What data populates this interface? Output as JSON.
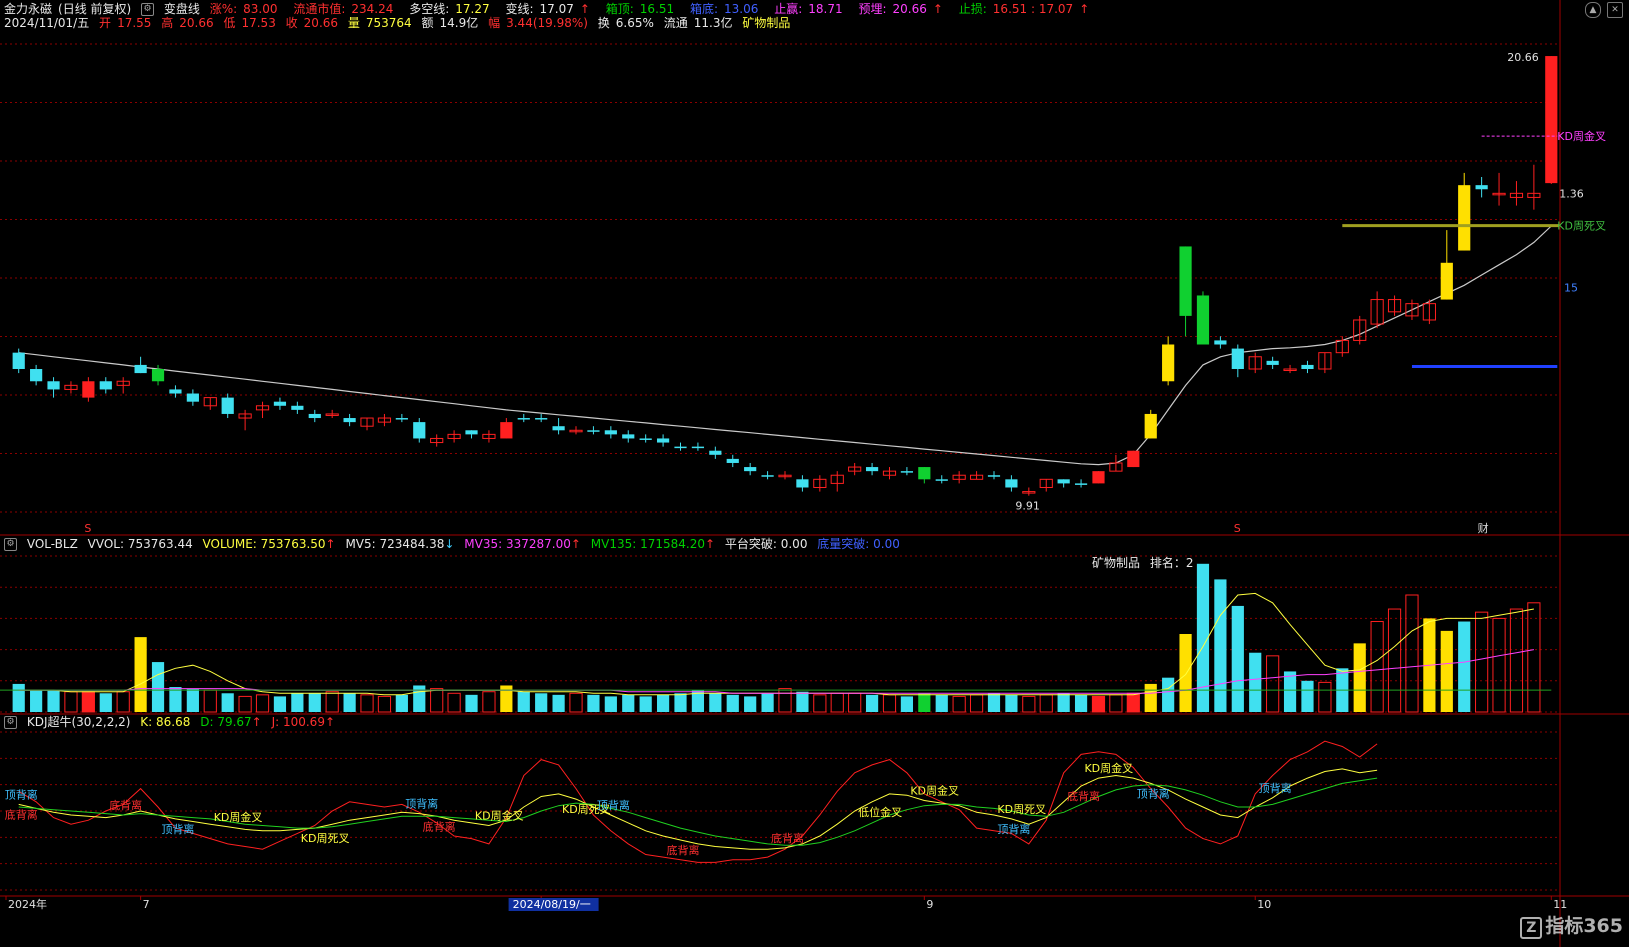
{
  "header": {
    "stock_name": "金力永磁",
    "period": "(日线 前复权)",
    "indicator": "变盘线",
    "zhang_label": "涨%:",
    "zhang_val": "83.00",
    "ltsz_label": "流通市值:",
    "ltsz_val": "234.24",
    "dkx_label": "多空线:",
    "dkx_val": "17.27",
    "bx_label": "变线:",
    "bx_val": "17.07",
    "xt_label": "箱顶:",
    "xt_val": "16.51",
    "xd_label": "箱底:",
    "xd_val": "13.06",
    "zy_label": "止赢:",
    "zy_val": "18.71",
    "yl_label": "预埋:",
    "yl_val": "20.66",
    "zs_label": "止损:",
    "zs_val": "16.51 : 17.07",
    "date": "2024/11/01/五",
    "open_label": "开",
    "open": "17.55",
    "high_label": "高",
    "high": "20.66",
    "low_label": "低",
    "low": "17.53",
    "close_label": "收",
    "close": "20.66",
    "vol_label": "量",
    "vol": "753764",
    "amt_label": "额",
    "amt": "14.9亿",
    "amp_label": "幅",
    "amp": "3.44(19.98%)",
    "turn_label": "换",
    "turn": "6.65%",
    "flow_label": "流通",
    "flow": "11.3亿",
    "sector": "矿物制品"
  },
  "price_panel": {
    "high_label": "20.66",
    "low_label": "9.91",
    "right_tag": "1.36",
    "edge_tag": "15",
    "kd_gold": "KD周金叉",
    "kd_dead": "KD周死叉",
    "markers": [
      {
        "text": "S",
        "color": "#ff3030",
        "pos": 4
      },
      {
        "text": "S",
        "color": "#ff3030",
        "pos": 70
      },
      {
        "text": "财",
        "color": "#dddddd",
        "pos": 84
      }
    ]
  },
  "vol_panel": {
    "name": "VOL-BLZ",
    "vvol": "VVOL: 753763.44",
    "volume": "VOLUME: 753763.50",
    "mv5": "MV5: 723484.38",
    "mv35": "MV35: 337287.00",
    "mv135": "MV135: 171584.20",
    "ptjp": "平台突破: 0.00",
    "dltp": "底量突破: 0.00",
    "sector_text": "矿物制品",
    "rank_text": "排名：2"
  },
  "kdj_panel": {
    "name": "KDJ超牛(30,2,2,2)",
    "k": "K: 86.68",
    "d": "D: 79.67",
    "j": "J: 100.69",
    "labels": [
      {
        "text": "顶背离",
        "color": "#40c0ff",
        "pos": 0
      },
      {
        "text": "底背离",
        "color": "#ff3030",
        "pos": 0
      },
      {
        "text": "底背离",
        "color": "#ff3030",
        "pos": 6
      },
      {
        "text": "顶背离",
        "color": "#40c0ff",
        "pos": 9
      },
      {
        "text": "KD周金叉",
        "color": "#ffff40",
        "pos": 12
      },
      {
        "text": "KD周死叉",
        "color": "#ffff40",
        "pos": 17
      },
      {
        "text": "顶背离",
        "color": "#40c0ff",
        "pos": 23
      },
      {
        "text": "底背离",
        "color": "#ff3030",
        "pos": 24
      },
      {
        "text": "KD周金叉",
        "color": "#ffff40",
        "pos": 27
      },
      {
        "text": "KD周死叉",
        "color": "#ffff40",
        "pos": 32
      },
      {
        "text": "顶背离",
        "color": "#40c0ff",
        "pos": 34
      },
      {
        "text": "底背离",
        "color": "#ff3030",
        "pos": 38
      },
      {
        "text": "底背离",
        "color": "#ff3030",
        "pos": 44
      },
      {
        "text": "低位金叉",
        "color": "#ffff40",
        "pos": 49
      },
      {
        "text": "KD周金叉",
        "color": "#ffff40",
        "pos": 52
      },
      {
        "text": "顶背离",
        "color": "#40c0ff",
        "pos": 57
      },
      {
        "text": "KD周死叉",
        "color": "#ffff40",
        "pos": 57
      },
      {
        "text": "底背离",
        "color": "#ff3030",
        "pos": 61
      },
      {
        "text": "KD周金叉",
        "color": "#ffff40",
        "pos": 62
      },
      {
        "text": "顶背离",
        "color": "#40c0ff",
        "pos": 65
      },
      {
        "text": "顶背离",
        "color": "#40c0ff",
        "pos": 72
      }
    ]
  },
  "xaxis": {
    "labels": [
      {
        "text": "2024年",
        "pos": 0
      },
      {
        "text": "7",
        "pos": 7
      },
      {
        "text": "8",
        "pos": 30
      },
      {
        "text": "9",
        "pos": 52
      },
      {
        "text": "10",
        "pos": 71
      },
      {
        "text": "11",
        "pos": 88
      }
    ],
    "cursor": "2024/08/19/一"
  },
  "logo": "指标365",
  "colors": {
    "up": "#ff2020",
    "down": "#40e0f0",
    "yellow": "#ffe000",
    "green": "#10d030",
    "ma": "#40d0e0",
    "ma2": "#e0e0e0",
    "grid": "#8b0000"
  },
  "chart_data": {
    "type": "candlestick",
    "ylim": [
      9.5,
      21.2
    ],
    "candles": [
      [
        13.4,
        13.5,
        12.9,
        13.0,
        "c"
      ],
      [
        13.0,
        13.1,
        12.6,
        12.7,
        "c"
      ],
      [
        12.7,
        12.8,
        12.3,
        12.5,
        "c"
      ],
      [
        12.5,
        12.7,
        12.4,
        12.6,
        "w"
      ],
      [
        12.3,
        12.8,
        12.2,
        12.7,
        "r"
      ],
      [
        12.7,
        12.8,
        12.4,
        12.5,
        "c"
      ],
      [
        12.6,
        12.8,
        12.4,
        12.7,
        "w"
      ],
      [
        12.9,
        13.3,
        12.9,
        13.1,
        "c"
      ],
      [
        12.7,
        13.1,
        12.6,
        13.0,
        "g"
      ],
      [
        12.5,
        12.6,
        12.3,
        12.4,
        "c"
      ],
      [
        12.4,
        12.5,
        12.1,
        12.2,
        "c"
      ],
      [
        12.1,
        12.3,
        12.0,
        12.3,
        "w"
      ],
      [
        12.3,
        12.4,
        11.8,
        11.9,
        "c"
      ],
      [
        11.8,
        12.0,
        11.5,
        11.9,
        "w"
      ],
      [
        12.0,
        12.2,
        11.8,
        12.1,
        "w"
      ],
      [
        12.2,
        12.3,
        12.0,
        12.1,
        "c"
      ],
      [
        12.1,
        12.2,
        11.9,
        12.0,
        "c"
      ],
      [
        11.9,
        12.0,
        11.7,
        11.8,
        "c"
      ],
      [
        11.9,
        12.0,
        11.8,
        11.9,
        "w"
      ],
      [
        11.8,
        11.9,
        11.6,
        11.7,
        "c"
      ],
      [
        11.6,
        11.8,
        11.5,
        11.8,
        "w"
      ],
      [
        11.8,
        11.9,
        11.6,
        11.7,
        "w"
      ],
      [
        11.8,
        11.9,
        11.7,
        11.8,
        "c"
      ],
      [
        11.7,
        11.8,
        11.2,
        11.3,
        "c"
      ],
      [
        11.2,
        11.4,
        11.1,
        11.3,
        "w"
      ],
      [
        11.3,
        11.5,
        11.2,
        11.4,
        "w"
      ],
      [
        11.5,
        11.5,
        11.3,
        11.4,
        "c"
      ],
      [
        11.3,
        11.5,
        11.2,
        11.4,
        "w"
      ],
      [
        11.3,
        11.8,
        11.3,
        11.7,
        "r"
      ],
      [
        11.8,
        11.9,
        11.7,
        11.8,
        "c"
      ],
      [
        11.8,
        11.9,
        11.7,
        11.8,
        "c"
      ],
      [
        11.6,
        11.8,
        11.4,
        11.5,
        "c"
      ],
      [
        11.5,
        11.6,
        11.4,
        11.5,
        "w"
      ],
      [
        11.5,
        11.6,
        11.4,
        11.5,
        "c"
      ],
      [
        11.5,
        11.6,
        11.3,
        11.4,
        "c"
      ],
      [
        11.3,
        11.5,
        11.2,
        11.4,
        "c"
      ],
      [
        11.3,
        11.4,
        11.2,
        11.3,
        "c"
      ],
      [
        11.3,
        11.4,
        11.1,
        11.2,
        "c"
      ],
      [
        11.1,
        11.2,
        11.0,
        11.1,
        "c"
      ],
      [
        11.1,
        11.2,
        11.0,
        11.1,
        "c"
      ],
      [
        11.0,
        11.1,
        10.8,
        10.9,
        "c"
      ],
      [
        10.8,
        10.9,
        10.6,
        10.7,
        "c"
      ],
      [
        10.6,
        10.7,
        10.4,
        10.5,
        "c"
      ],
      [
        10.4,
        10.5,
        10.3,
        10.4,
        "c"
      ],
      [
        10.4,
        10.5,
        10.3,
        10.4,
        "w"
      ],
      [
        10.3,
        10.4,
        10.0,
        10.1,
        "c"
      ],
      [
        10.1,
        10.4,
        10.0,
        10.3,
        "w"
      ],
      [
        10.2,
        10.5,
        10.0,
        10.4,
        "w"
      ],
      [
        10.5,
        10.7,
        10.4,
        10.6,
        "w"
      ],
      [
        10.6,
        10.7,
        10.4,
        10.5,
        "c"
      ],
      [
        10.4,
        10.6,
        10.3,
        10.5,
        "w"
      ],
      [
        10.5,
        10.6,
        10.4,
        10.5,
        "c"
      ],
      [
        10.6,
        10.6,
        10.2,
        10.3,
        "g"
      ],
      [
        10.3,
        10.4,
        10.2,
        10.3,
        "c"
      ],
      [
        10.3,
        10.5,
        10.2,
        10.4,
        "w"
      ],
      [
        10.3,
        10.5,
        10.3,
        10.4,
        "w"
      ],
      [
        10.4,
        10.5,
        10.3,
        10.4,
        "c"
      ],
      [
        10.3,
        10.4,
        10.0,
        10.1,
        "c"
      ],
      [
        10.0,
        10.1,
        9.9,
        10.0,
        "w"
      ],
      [
        10.1,
        10.3,
        10.0,
        10.3,
        "w"
      ],
      [
        10.3,
        10.3,
        10.1,
        10.2,
        "c"
      ],
      [
        10.2,
        10.3,
        10.1,
        10.2,
        "c"
      ],
      [
        10.2,
        10.5,
        10.2,
        10.5,
        "r"
      ],
      [
        10.5,
        10.9,
        10.5,
        10.7,
        "w"
      ],
      [
        10.6,
        11.0,
        10.6,
        11.0,
        "r"
      ],
      [
        11.3,
        12.0,
        11.3,
        11.9,
        "y"
      ],
      [
        12.7,
        13.8,
        12.6,
        13.6,
        "y"
      ],
      [
        16.0,
        16.0,
        13.8,
        14.3,
        "g"
      ],
      [
        14.8,
        14.9,
        13.6,
        13.6,
        "g"
      ],
      [
        13.7,
        13.8,
        13.5,
        13.6,
        "c"
      ],
      [
        13.5,
        13.6,
        12.8,
        13.0,
        "c"
      ],
      [
        13.0,
        13.4,
        12.9,
        13.3,
        "w"
      ],
      [
        13.2,
        13.3,
        13.0,
        13.1,
        "c"
      ],
      [
        13.0,
        13.1,
        12.9,
        13.0,
        "w"
      ],
      [
        13.1,
        13.2,
        12.9,
        13.0,
        "c"
      ],
      [
        13.0,
        13.4,
        12.9,
        13.4,
        "w"
      ],
      [
        13.4,
        13.8,
        13.3,
        13.7,
        "w"
      ],
      [
        13.7,
        14.3,
        13.6,
        14.2,
        "w"
      ],
      [
        14.1,
        14.9,
        14.0,
        14.7,
        "w"
      ],
      [
        14.4,
        14.8,
        14.3,
        14.7,
        "w"
      ],
      [
        14.3,
        14.7,
        14.2,
        14.6,
        "w"
      ],
      [
        14.2,
        14.7,
        14.1,
        14.6,
        "w"
      ],
      [
        14.7,
        16.4,
        14.7,
        15.6,
        "y"
      ],
      [
        15.9,
        17.8,
        15.9,
        17.5,
        "y"
      ],
      [
        17.4,
        17.7,
        17.2,
        17.5,
        "c"
      ],
      [
        17.3,
        17.8,
        17.0,
        17.3,
        "w"
      ],
      [
        17.3,
        17.6,
        17.0,
        17.2,
        "w"
      ],
      [
        17.2,
        18.0,
        16.9,
        17.3,
        "w"
      ],
      [
        17.55,
        20.66,
        17.53,
        20.66,
        "r"
      ]
    ],
    "ma": [
      13.4,
      13.35,
      13.3,
      13.25,
      13.2,
      13.15,
      13.1,
      13.05,
      13.0,
      12.95,
      12.9,
      12.85,
      12.8,
      12.75,
      12.7,
      12.65,
      12.6,
      12.55,
      12.5,
      12.45,
      12.4,
      12.35,
      12.3,
      12.25,
      12.2,
      12.15,
      12.1,
      12.05,
      12.0,
      11.96,
      11.92,
      11.88,
      11.84,
      11.8,
      11.76,
      11.72,
      11.68,
      11.64,
      11.6,
      11.56,
      11.52,
      11.48,
      11.44,
      11.4,
      11.36,
      11.32,
      11.28,
      11.24,
      11.2,
      11.16,
      11.12,
      11.08,
      11.04,
      11.0,
      10.96,
      10.92,
      10.88,
      10.84,
      10.8,
      10.76,
      10.72,
      10.68,
      10.66,
      10.7,
      10.9,
      11.4,
      12.0,
      12.6,
      13.1,
      13.3,
      13.4,
      13.45,
      13.5,
      13.52,
      13.55,
      13.6,
      13.7,
      13.85,
      14.05,
      14.25,
      14.45,
      14.65,
      14.85,
      15.05,
      15.3,
      15.55,
      15.8,
      16.1,
      16.5
    ],
    "volume": [
      18,
      14,
      14,
      13,
      13,
      12,
      13,
      48,
      32,
      16,
      15,
      14,
      12,
      10,
      11,
      10,
      12,
      12,
      13,
      12,
      11,
      10,
      11,
      17,
      15,
      12,
      11,
      13,
      17,
      13,
      12,
      11,
      12,
      11,
      10,
      11,
      10,
      11,
      12,
      14,
      12,
      11,
      10,
      12,
      15,
      13,
      11,
      12,
      12,
      11,
      11,
      10,
      12,
      11,
      10,
      11,
      12,
      11,
      10,
      11,
      12,
      11,
      10,
      11,
      12,
      18,
      22,
      50,
      95,
      85,
      68,
      38,
      36,
      26,
      20,
      19,
      28,
      44,
      58,
      66,
      75,
      60,
      52,
      58,
      64,
      60,
      66,
      70
    ],
    "volume_colors": [
      "c",
      "c",
      "c",
      "w",
      "r",
      "c",
      "w",
      "y",
      "c",
      "c",
      "c",
      "w",
      "c",
      "w",
      "w",
      "c",
      "c",
      "c",
      "w",
      "c",
      "w",
      "w",
      "c",
      "c",
      "w",
      "w",
      "c",
      "w",
      "y",
      "c",
      "c",
      "c",
      "w",
      "c",
      "c",
      "c",
      "c",
      "c",
      "c",
      "c",
      "c",
      "c",
      "c",
      "c",
      "w",
      "c",
      "w",
      "w",
      "w",
      "c",
      "w",
      "c",
      "g",
      "c",
      "w",
      "w",
      "c",
      "c",
      "w",
      "w",
      "c",
      "c",
      "r",
      "w",
      "r",
      "y",
      "c",
      "y",
      "c",
      "c",
      "c",
      "c",
      "w",
      "c",
      "c",
      "w",
      "c",
      "y",
      "w",
      "w",
      "w",
      "y",
      "y",
      "c",
      "w",
      "w",
      "w",
      "w"
    ],
    "vol_ma5": [
      14,
      14,
      14,
      13,
      13,
      13,
      13,
      18,
      24,
      28,
      30,
      26,
      20,
      15,
      13,
      12,
      12,
      12,
      12,
      12,
      12,
      11,
      11,
      13,
      14,
      14,
      14,
      14,
      14,
      13,
      13,
      13,
      13,
      12,
      12,
      11,
      11,
      11,
      11,
      12,
      12,
      12,
      12,
      12,
      12,
      12,
      12,
      12,
      12,
      12,
      11,
      11,
      11,
      11,
      11,
      11,
      11,
      11,
      11,
      11,
      11,
      11,
      11,
      11,
      11,
      13,
      15,
      24,
      42,
      62,
      75,
      76,
      70,
      56,
      43,
      30,
      26,
      27,
      33,
      42,
      52,
      58,
      60,
      60,
      60,
      62,
      64,
      66
    ],
    "vol_ma35": [
      14,
      14,
      14,
      14,
      14,
      14,
      14,
      15,
      15,
      15,
      15,
      15,
      15,
      15,
      14,
      14,
      14,
      14,
      14,
      14,
      14,
      14,
      14,
      14,
      14,
      14,
      14,
      14,
      14,
      14,
      14,
      14,
      14,
      14,
      14,
      13,
      13,
      13,
      13,
      13,
      13,
      12,
      12,
      12,
      12,
      12,
      12,
      12,
      12,
      12,
      12,
      12,
      12,
      12,
      12,
      12,
      12,
      12,
      12,
      12,
      12,
      12,
      12,
      12,
      12,
      12,
      13,
      14,
      16,
      18,
      20,
      21,
      22,
      23,
      24,
      24,
      25,
      26,
      27,
      28,
      29,
      30,
      31,
      32,
      34,
      36,
      38,
      40
    ],
    "kdj_k": [
      60,
      57,
      54,
      52,
      51,
      50,
      52,
      55,
      52,
      49,
      47,
      45,
      43,
      41,
      40,
      40,
      41,
      42,
      45,
      48,
      50,
      52,
      54,
      53,
      51,
      48,
      46,
      44,
      48,
      58,
      66,
      68,
      64,
      58,
      52,
      46,
      40,
      36,
      33,
      30,
      28,
      27,
      26,
      26,
      27,
      30,
      36,
      45,
      55,
      62,
      68,
      67,
      63,
      61,
      59,
      54,
      52,
      49,
      45,
      50,
      62,
      74,
      80,
      82,
      80,
      76,
      71,
      64,
      58,
      52,
      50,
      58,
      65,
      74,
      80,
      85,
      87,
      84,
      86
    ],
    "kdj_d": [
      58,
      57,
      56,
      55,
      54,
      53,
      52,
      53,
      52,
      51,
      50,
      49,
      47,
      45,
      44,
      43,
      42,
      42,
      43,
      45,
      47,
      49,
      51,
      51,
      51,
      50,
      49,
      48,
      47,
      50,
      55,
      59,
      61,
      60,
      57,
      54,
      50,
      46,
      42,
      39,
      36,
      34,
      32,
      30,
      29,
      29,
      31,
      35,
      40,
      46,
      52,
      56,
      59,
      60,
      60,
      58,
      57,
      55,
      52,
      51,
      54,
      60,
      66,
      71,
      74,
      75,
      74,
      71,
      67,
      62,
      58,
      58,
      60,
      64,
      68,
      72,
      76,
      78,
      80
    ],
    "kdj_j": [
      70,
      62,
      50,
      45,
      48,
      55,
      60,
      72,
      58,
      42,
      38,
      34,
      30,
      28,
      26,
      32,
      38,
      44,
      55,
      62,
      60,
      58,
      60,
      54,
      46,
      36,
      34,
      30,
      50,
      82,
      94,
      90,
      72,
      52,
      40,
      30,
      22,
      20,
      18,
      16,
      16,
      18,
      18,
      20,
      26,
      36,
      52,
      70,
      84,
      90,
      94,
      84,
      68,
      62,
      56,
      42,
      40,
      38,
      30,
      48,
      84,
      98,
      100,
      98,
      88,
      72,
      58,
      42,
      34,
      30,
      36,
      68,
      82,
      94,
      100,
      108,
      104,
      96,
      106
    ]
  }
}
